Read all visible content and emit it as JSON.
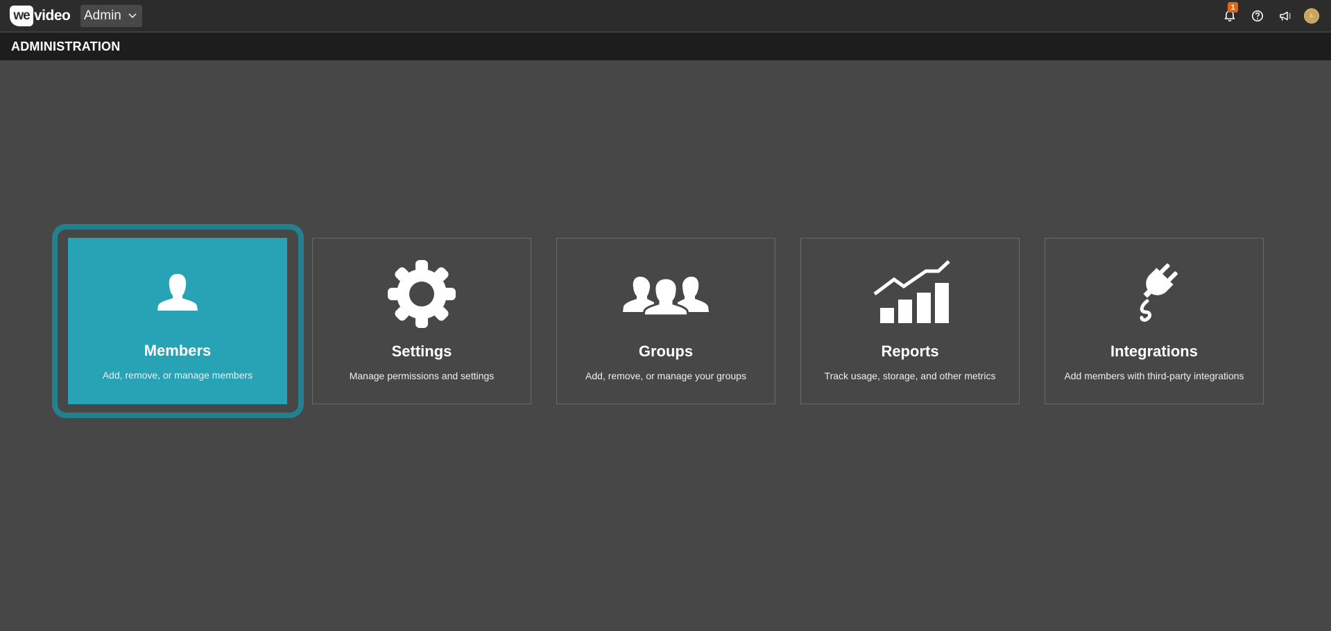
{
  "app": {
    "logo_we": "we",
    "logo_video": "video"
  },
  "account_switcher": {
    "selected": "Admin",
    "icon": "chevron-down-icon"
  },
  "top_icons": {
    "notifications": {
      "icon": "bell-icon",
      "badge": "1"
    },
    "help": {
      "icon": "help-circle-icon"
    },
    "announcements": {
      "icon": "megaphone-icon"
    },
    "avatar": {
      "initials": "JL"
    }
  },
  "subheader": {
    "title": "ADMINISTRATION"
  },
  "cards": [
    {
      "id": "members",
      "title": "Members",
      "description": "Add, remove, or manage members",
      "icon": "user-icon",
      "active": true
    },
    {
      "id": "settings",
      "title": "Settings",
      "description": "Manage permissions and settings",
      "icon": "gear-icon",
      "active": false
    },
    {
      "id": "groups",
      "title": "Groups",
      "description": "Add, remove, or manage your groups",
      "icon": "group-icon",
      "active": false
    },
    {
      "id": "reports",
      "title": "Reports",
      "description": "Track usage, storage, and other metrics",
      "icon": "chart-icon",
      "active": false
    },
    {
      "id": "integrations",
      "title": "Integrations",
      "description": "Add members with third-party integrations",
      "icon": "plug-icon",
      "active": false
    }
  ],
  "colors": {
    "background": "#474747",
    "topbar": "#2c2c2c",
    "subheader": "#1d1d1d",
    "accent": "#27a3b5",
    "focus_ring": "#23808e",
    "badge": "#d86b1b"
  }
}
